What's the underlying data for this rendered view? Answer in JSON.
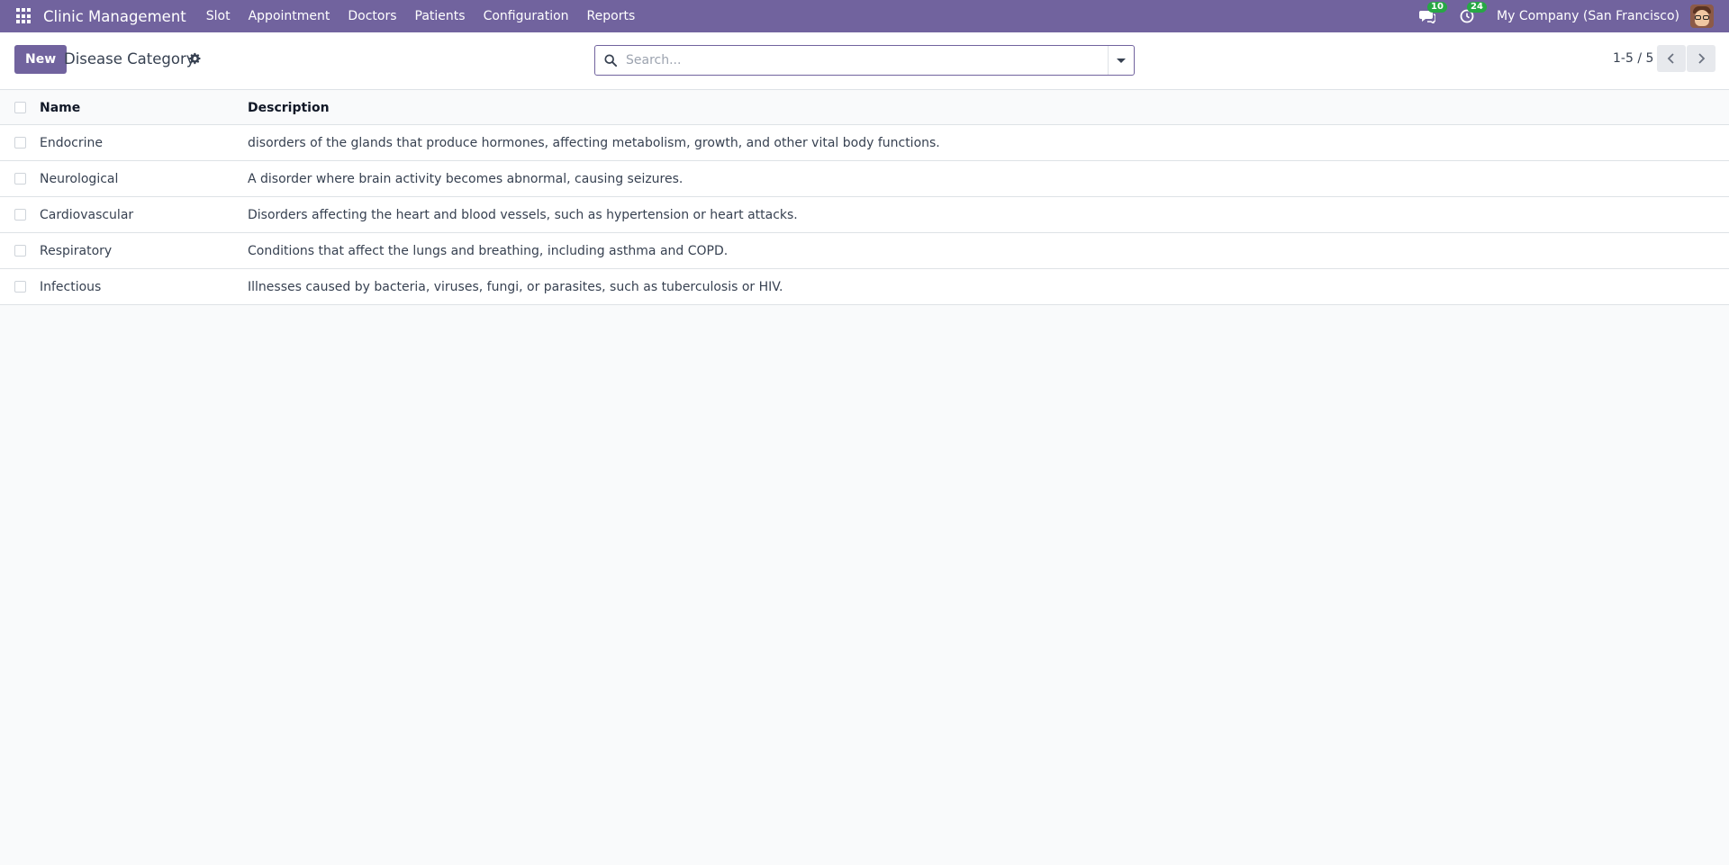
{
  "navbar": {
    "brand": "Clinic Management",
    "menu": [
      "Slot",
      "Appointment",
      "Doctors",
      "Patients",
      "Configuration",
      "Reports"
    ],
    "messages_count": "10",
    "activities_count": "24",
    "company": "My Company (San Francisco)"
  },
  "control": {
    "new_label": "New",
    "title": "Disease Category",
    "search_placeholder": "Search...",
    "pager": "1-5 / 5"
  },
  "table": {
    "headers": {
      "name": "Name",
      "description": "Description"
    },
    "rows": [
      {
        "name": "Endocrine",
        "description": "disorders of the glands that produce hormones, affecting metabolism, growth, and other vital body functions."
      },
      {
        "name": "Neurological",
        "description": "A disorder where brain activity becomes abnormal, causing seizures."
      },
      {
        "name": "Cardiovascular",
        "description": "Disorders affecting the heart and blood vessels, such as hypertension or heart attacks."
      },
      {
        "name": "Respiratory",
        "description": "Conditions that affect the lungs and breathing, including asthma and COPD."
      },
      {
        "name": "Infectious",
        "description": "Illnesses caused by bacteria, viruses, fungi, or parasites, such as tuberculosis or HIV."
      }
    ]
  },
  "colors": {
    "brand": "#71639e",
    "badge": "#27a745"
  }
}
